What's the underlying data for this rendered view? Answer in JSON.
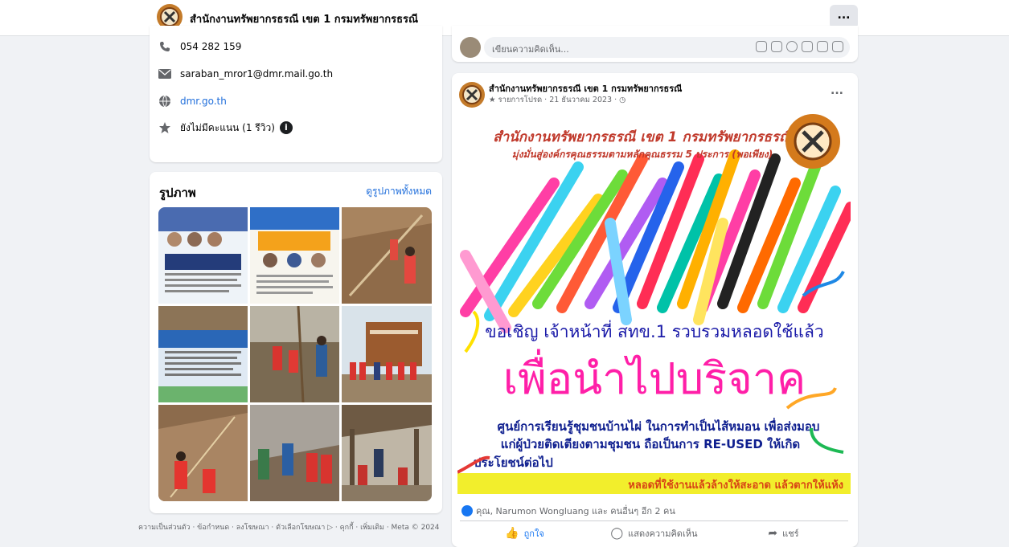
{
  "header": {
    "page_name": "สำนักงานทรัพยากรธรณี เขต 1 กรมทรัพยากรธรณี",
    "more_label": "..."
  },
  "intro": {
    "phone": "054 282 159",
    "email": "saraban_mror1@dmr.mail.go.th",
    "website": "dmr.go.th",
    "rating": "ยังไม่มีคะแนน (1 รีวิว)"
  },
  "photos": {
    "title": "รูปภาพ",
    "see_all": "ดูรูปภาพทั้งหมด",
    "count": 9
  },
  "footer": {
    "links": "ความเป็นส่วนตัว · ข้อกำหนด · ลงโฆษณา · ตัวเลือกโฆษณา ▷ · คุกกี้ · เพิ่มเติม · Meta © 2024"
  },
  "composer": {
    "placeholder": "เขียนความคิดเห็น..."
  },
  "post": {
    "author": "สำนักงานทรัพยากรธรณี เขต 1 กรมทรัพยากรธรณี",
    "meta": "★ รายการโปรด · 21 ธันวาคม 2023 · ◷",
    "more_label": "...",
    "poster": {
      "headline": "สำนักงานทรัพยากรธรณี เขต 1 กรมทรัพยากรธรณี",
      "subline": "มุ่งมั่นสู่องค์กรคุณธรรมตามหลักคุณธรรม 5 ประการ (พอเพียง)",
      "invite": "ขอเชิญ เจ้าหน้าที่ สทข.1 รวบรวมหลอดใช้แล้ว",
      "big": "เพื่อนำไปบริจาค",
      "body1": "ศูนย์การเรียนรู้ชุมชนบ้านไผ่ ในการทำเป็นไส้หมอน เพื่อส่งมอบ",
      "body2": "แก่ผู้ป่วยติดเตียงตามชุมชน ถือเป็นการ RE-USED ให้เกิด",
      "body3": "ประโยชน์ต่อไป",
      "banner": "หลอดที่ใช้งานแล้วล้างให้สะอาด แล้วตากให้แห้ง"
    },
    "reactions": "คุณ, Narumon Wongluang และ คนอื่นๆ อีก 2 คน",
    "like": "ถูกใจ",
    "comment": "แสดงความคิดเห็น",
    "share": "แชร์"
  },
  "colors": {
    "accent": "#1877f2",
    "link": "#216fdb",
    "poster_title": "#c0392b",
    "poster_big": "#ff1fa8",
    "poster_blue": "#0f1f8f",
    "banner": "#f2ee2c"
  }
}
